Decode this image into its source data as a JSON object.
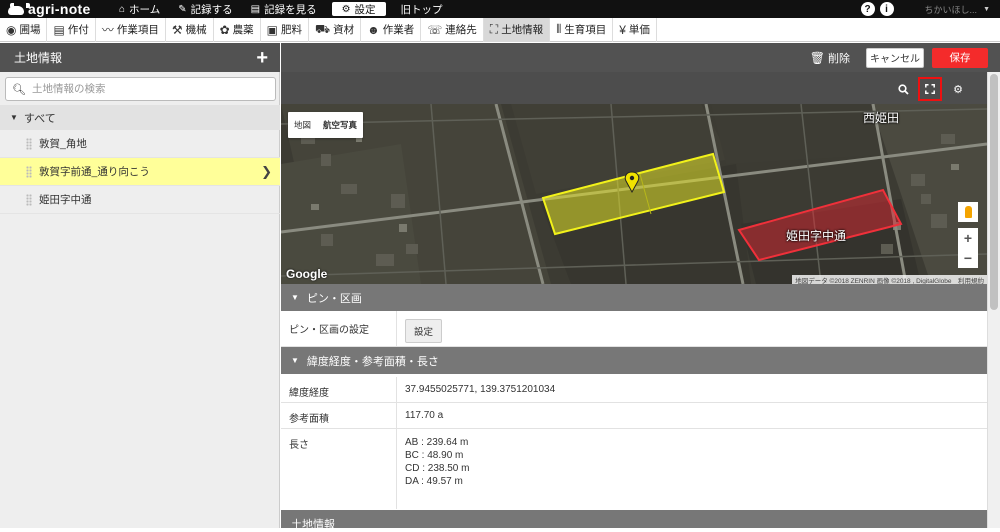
{
  "topbar": {
    "logo": "agri-note",
    "nav": [
      {
        "icon": "⌂",
        "label": "ホーム"
      },
      {
        "icon": "✎",
        "label": "記録する"
      },
      {
        "icon": "▤",
        "label": "記録を見る"
      },
      {
        "icon": "⚙",
        "label": "設定"
      },
      {
        "icon": "",
        "label": "旧トップ"
      }
    ],
    "help_glyph": "?",
    "info_glyph": "i",
    "user_text": "ちかいほし..."
  },
  "menu": [
    {
      "icon": "◉",
      "label": "圃場"
    },
    {
      "icon": "▤",
      "label": "作付"
    },
    {
      "icon": "〰",
      "label": "作業項目"
    },
    {
      "icon": "⚒",
      "label": "機械"
    },
    {
      "icon": "✿",
      "label": "農薬"
    },
    {
      "icon": "▣",
      "label": "肥料"
    },
    {
      "icon": "⛟",
      "label": "資材"
    },
    {
      "icon": "☻",
      "label": "作業者"
    },
    {
      "icon": "☏",
      "label": "連絡先"
    },
    {
      "icon": "⛶",
      "label": "土地情報"
    },
    {
      "icon": "⫴",
      "label": "生育項目"
    },
    {
      "icon": "¥",
      "label": "単価"
    }
  ],
  "left": {
    "title": "土地情報",
    "add_glyph": "+",
    "search_placeholder": "土地情報の検索",
    "root": "すべて",
    "items": [
      "敦賀_角地",
      "敦賀字前通_通り向こう",
      "姫田字中通"
    ],
    "selected_index": 1
  },
  "header": {
    "delete_label": "削除",
    "cancel_label": "キャンセル",
    "save_label": "保存",
    "colors": {
      "save": "#f42b2b",
      "highlight": "#ffff99"
    }
  },
  "map": {
    "type_options": [
      "地図",
      "航空写真"
    ],
    "active_type": "航空写真",
    "place_label": "西姫田",
    "field_label": "姫田字中通",
    "logo": "Google",
    "attribution": "地図データ ©2018 ZENRIN 画像 ©2018 , DigitalGlobe　利用規約",
    "zoom_in": "+",
    "zoom_out": "−"
  },
  "sections": {
    "pin": {
      "title": "ピン・区画",
      "row_label": "ピン・区画の設定",
      "button": "設定"
    },
    "coords": {
      "title": "緯度経度・参考面積・長さ",
      "rows": [
        {
          "label": "緯度経度",
          "value": "37.9455025771, 139.3751201034"
        },
        {
          "label": "参考面積",
          "value": "117.70 a"
        }
      ],
      "length_label": "長さ",
      "lengths": [
        "AB : 239.64 m",
        "BC : 48.90 m",
        "CD : 238.50 m",
        "DA : 49.57 m"
      ]
    },
    "land": {
      "title": "土地情報"
    }
  }
}
